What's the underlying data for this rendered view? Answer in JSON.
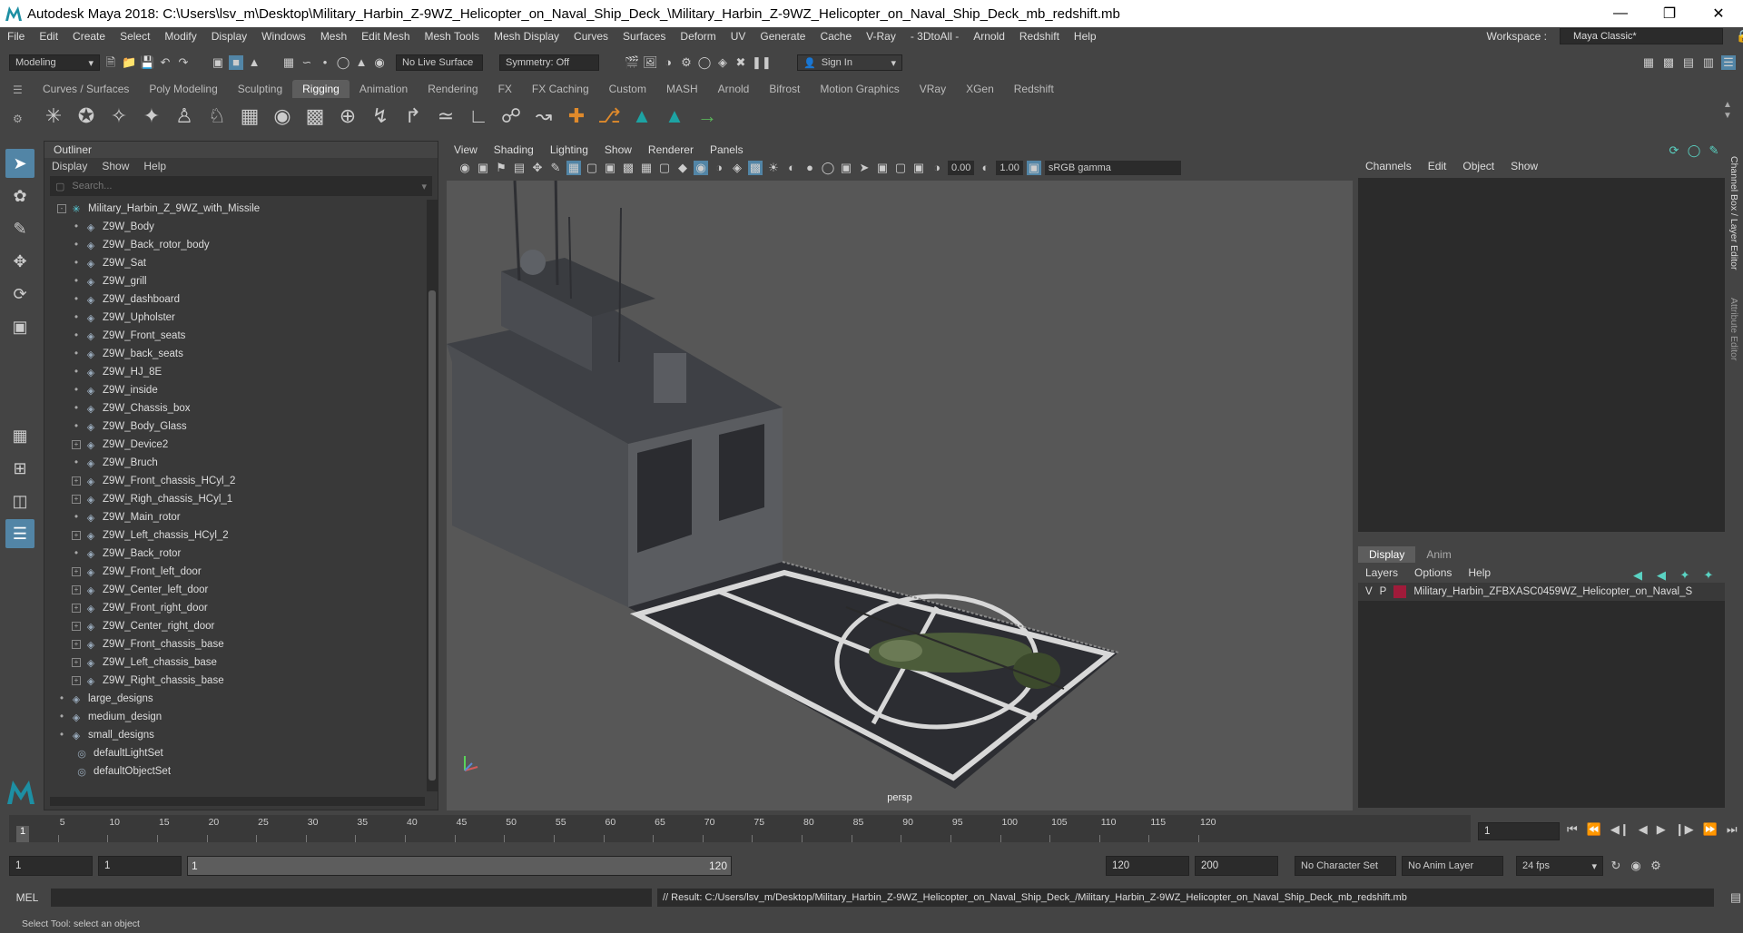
{
  "window": {
    "title": "Autodesk Maya 2018: C:\\Users\\lsv_m\\Desktop\\Military_Harbin_Z-9WZ_Helicopter_on_Naval_Ship_Deck_\\Military_Harbin_Z-9WZ_Helicopter_on_Naval_Ship_Deck_mb_redshift.mb"
  },
  "menubar": {
    "items": [
      "File",
      "Edit",
      "Create",
      "Select",
      "Modify",
      "Display",
      "Windows",
      "Mesh",
      "Edit Mesh",
      "Mesh Tools",
      "Mesh Display",
      "Curves",
      "Surfaces",
      "Deform",
      "UV",
      "Generate",
      "Cache",
      "V-Ray",
      "- 3DtoAll -",
      "Arnold",
      "Redshift",
      "Help"
    ],
    "workspace_label": "Workspace :",
    "workspace_value": "Maya Classic*"
  },
  "toolbar": {
    "mode": "Modeling",
    "live_surface": "No Live Surface",
    "symmetry": "Symmetry: Off",
    "sign_in": "Sign In"
  },
  "shelf_tabs": [
    "Curves / Surfaces",
    "Poly Modeling",
    "Sculpting",
    "Rigging",
    "Animation",
    "Rendering",
    "FX",
    "FX Caching",
    "Custom",
    "MASH",
    "Arnold",
    "Bifrost",
    "Motion Graphics",
    "VRay",
    "XGen",
    "Redshift"
  ],
  "shelf_active": "Rigging",
  "outliner": {
    "title": "Outliner",
    "menu": [
      "Display",
      "Show",
      "Help"
    ],
    "search_placeholder": "Search...",
    "items": [
      {
        "label": "Military_Harbin_Z_9WZ_with_Missile",
        "level": 0,
        "kind": "group"
      },
      {
        "label": "Z9W_Body",
        "level": 1,
        "kind": "mesh"
      },
      {
        "label": "Z9W_Back_rotor_body",
        "level": 1,
        "kind": "mesh"
      },
      {
        "label": "Z9W_Sat",
        "level": 1,
        "kind": "mesh"
      },
      {
        "label": "Z9W_grill",
        "level": 1,
        "kind": "mesh"
      },
      {
        "label": "Z9W_dashboard",
        "level": 1,
        "kind": "mesh"
      },
      {
        "label": "Z9W_Upholster",
        "level": 1,
        "kind": "mesh"
      },
      {
        "label": "Z9W_Front_seats",
        "level": 1,
        "kind": "mesh"
      },
      {
        "label": "Z9W_back_seats",
        "level": 1,
        "kind": "mesh"
      },
      {
        "label": "Z9W_HJ_8E",
        "level": 1,
        "kind": "mesh"
      },
      {
        "label": "Z9W_inside",
        "level": 1,
        "kind": "mesh"
      },
      {
        "label": "Z9W_Chassis_box",
        "level": 1,
        "kind": "mesh"
      },
      {
        "label": "Z9W_Body_Glass",
        "level": 1,
        "kind": "mesh"
      },
      {
        "label": "Z9W_Device2",
        "level": 1,
        "kind": "expand"
      },
      {
        "label": "Z9W_Bruch",
        "level": 1,
        "kind": "mesh"
      },
      {
        "label": "Z9W_Front_chassis_HCyl_2",
        "level": 1,
        "kind": "expand"
      },
      {
        "label": "Z9W_Righ_chassis_HCyl_1",
        "level": 1,
        "kind": "expand"
      },
      {
        "label": "Z9W_Main_rotor",
        "level": 1,
        "kind": "mesh"
      },
      {
        "label": "Z9W_Left_chassis_HCyl_2",
        "level": 1,
        "kind": "expand"
      },
      {
        "label": "Z9W_Back_rotor",
        "level": 1,
        "kind": "mesh"
      },
      {
        "label": "Z9W_Front_left_door",
        "level": 1,
        "kind": "expand"
      },
      {
        "label": "Z9W_Center_left_door",
        "level": 1,
        "kind": "expand"
      },
      {
        "label": "Z9W_Front_right_door",
        "level": 1,
        "kind": "expand"
      },
      {
        "label": "Z9W_Center_right_door",
        "level": 1,
        "kind": "expand"
      },
      {
        "label": "Z9W_Front_chassis_base",
        "level": 1,
        "kind": "expand"
      },
      {
        "label": "Z9W_Left_chassis_base",
        "level": 1,
        "kind": "expand"
      },
      {
        "label": "Z9W_Right_chassis_base",
        "level": 1,
        "kind": "expand"
      },
      {
        "label": "large_designs",
        "level": 0,
        "kind": "mesh"
      },
      {
        "label": "medium_design",
        "level": 0,
        "kind": "mesh"
      },
      {
        "label": "small_designs",
        "level": 0,
        "kind": "mesh"
      },
      {
        "label": "defaultLightSet",
        "level": 0,
        "kind": "set"
      },
      {
        "label": "defaultObjectSet",
        "level": 0,
        "kind": "set"
      }
    ]
  },
  "viewport": {
    "menu": [
      "View",
      "Shading",
      "Lighting",
      "Show",
      "Renderer",
      "Panels"
    ],
    "exposure": "0.00",
    "gamma": "1.00",
    "color_space": "sRGB gamma",
    "camera_label": "persp"
  },
  "channel_box": {
    "menu": [
      "Channels",
      "Edit",
      "Object",
      "Show"
    ]
  },
  "layer_editor": {
    "tabs": [
      "Display",
      "Anim"
    ],
    "menu": [
      "Layers",
      "Options",
      "Help"
    ],
    "layer": {
      "v": "V",
      "p": "P",
      "name": "Military_Harbin_ZFBXASC0459WZ_Helicopter_on_Naval_S",
      "color": "#a01b3a"
    }
  },
  "side_tabs": [
    "Channel Box / Layer Editor",
    "Attribute Editor"
  ],
  "timeline": {
    "ticks": [
      "5",
      "10",
      "15",
      "20",
      "25",
      "30",
      "35",
      "40",
      "45",
      "50",
      "55",
      "60",
      "65",
      "70",
      "75",
      "80",
      "85",
      "90",
      "95",
      "100",
      "105",
      "110",
      "115",
      "120"
    ],
    "start_label": "1",
    "current_frame": "1"
  },
  "range": {
    "start": "1",
    "playback_start": "1",
    "slider_start": "1",
    "slider_end": "120",
    "playback_end": "120",
    "end": "200",
    "character_set": "No Character Set",
    "anim_layer": "No Anim Layer",
    "fps": "24 fps"
  },
  "mel": {
    "label": "MEL",
    "result": "// Result: C:/Users/lsv_m/Desktop/Military_Harbin_Z-9WZ_Helicopter_on_Naval_Ship_Deck_/Military_Harbin_Z-9WZ_Helicopter_on_Naval_Ship_Deck_mb_redshift.mb"
  },
  "help_line": "Select Tool: select an object"
}
